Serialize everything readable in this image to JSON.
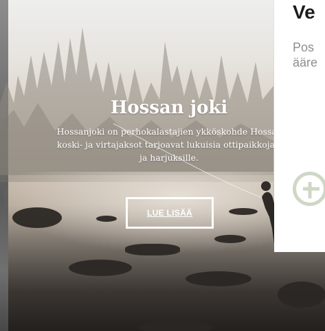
{
  "hero": {
    "title": "Hossan joki",
    "body_lines": [
      "Hossanjoki on perhokalastajien ykköskohde Hossas",
      "koski- ja virtajaksot tarjoavat lukuisia ottipaikkoja t",
      "ja harjuksille."
    ],
    "cta_label": "LUE LISÄÄ"
  },
  "side_card": {
    "title": "Ve",
    "description_lines": [
      "Pos",
      "ääre"
    ],
    "plus_icon": "plus-circle-icon"
  }
}
